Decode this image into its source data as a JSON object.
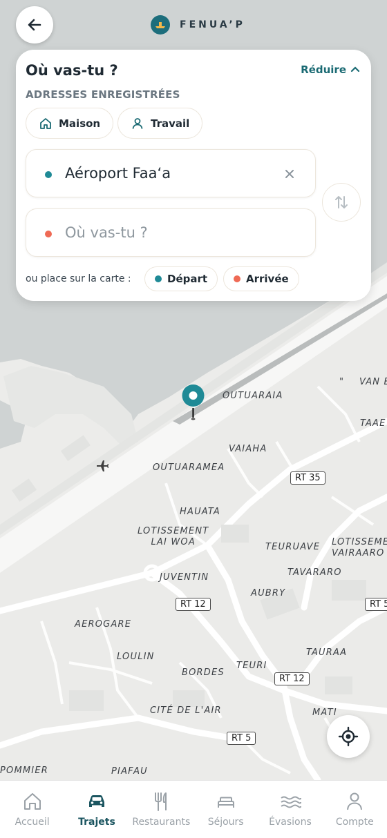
{
  "header": {
    "brand": "FENUA’P"
  },
  "search_panel": {
    "title": "Où vas-tu ?",
    "reduce_label": "Réduire",
    "saved_addresses_title": "ADRESSES ENREGISTRÉES",
    "saved": [
      {
        "label": "Maison",
        "icon": "home-icon"
      },
      {
        "label": "Travail",
        "icon": "person-icon"
      }
    ],
    "origin": {
      "value": "Aéroport Faa‘a",
      "dot_color": "#1f8a96"
    },
    "destination": {
      "placeholder": "Où vas-tu ?",
      "dot_color": "#ef6a55"
    },
    "place_on_map_label": "ou place sur la carte :",
    "place_buttons": {
      "departure": "Départ",
      "arrival": "Arrivée"
    }
  },
  "map": {
    "labels": {
      "outuaraia": "OUTUARAIA",
      "vaiaha": "VAIAHA",
      "outuaramea": "OUTUARAMEA",
      "hauata": "HAUATA",
      "lotissement_lai_woa": "LOTISSEMENT\nLAI WOA",
      "teuruave": "TEURUAVE",
      "lotissement_vairaaro": "LOTISSEME\nVAIRAARO",
      "tavararo": "TAVARARO",
      "juventin": "JUVENTIN",
      "aubry": "AUBRY",
      "aerogare": "AEROGARE",
      "loulin": "LOULIN",
      "bordes": "BORDES",
      "teuri": "TEURI",
      "tauraa": "TAURAA",
      "cite_de_lair": "CITÉ DE L'AIR",
      "mati": "MATI",
      "pommier": "POMMIER",
      "piafau": "PIAFAU",
      "taae": "TAAE",
      "van_e": "VAN E",
      "quote": "\""
    },
    "roads": {
      "rt35": "RT 35",
      "rt12a": "RT 12",
      "rt12b": "RT 12",
      "rt5a": "RT 5",
      "rt5b": "RT 5"
    }
  },
  "bottom_nav": [
    {
      "label": "Accueil",
      "icon": "home-icon",
      "active": false
    },
    {
      "label": "Trajets",
      "icon": "car-icon",
      "active": true
    },
    {
      "label": "Restaurants",
      "icon": "cutlery-icon",
      "active": false
    },
    {
      "label": "Séjours",
      "icon": "bed-icon",
      "active": false
    },
    {
      "label": "Évasions",
      "icon": "waves-icon",
      "active": false
    },
    {
      "label": "Compte",
      "icon": "person-icon",
      "active": false
    }
  ]
}
